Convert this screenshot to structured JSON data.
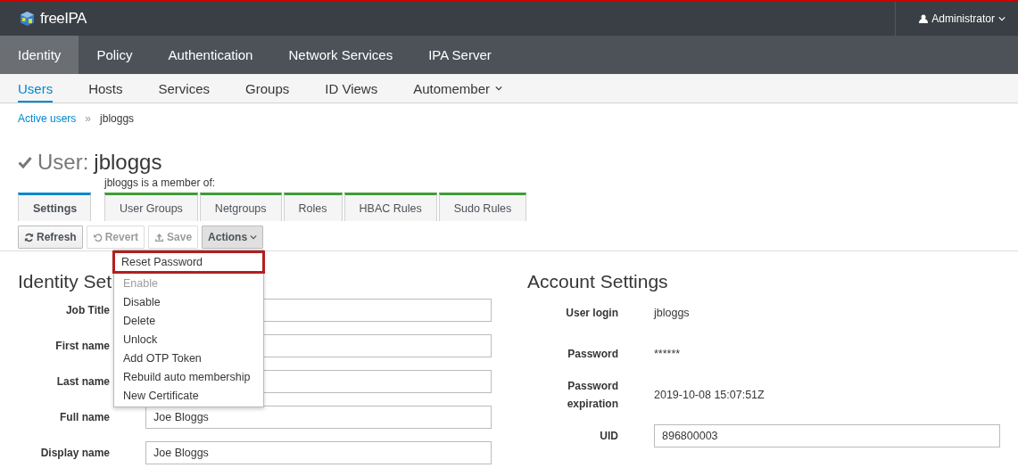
{
  "header": {
    "brand": "freeIPA",
    "user": "Administrator"
  },
  "nav": [
    {
      "label": "Identity",
      "selected": true
    },
    {
      "label": "Policy",
      "selected": false
    },
    {
      "label": "Authentication",
      "selected": false
    },
    {
      "label": "Network Services",
      "selected": false
    },
    {
      "label": "IPA Server",
      "selected": false
    }
  ],
  "subnav": [
    {
      "label": "Users",
      "selected": true,
      "dropdown": false
    },
    {
      "label": "Hosts",
      "selected": false,
      "dropdown": false
    },
    {
      "label": "Services",
      "selected": false,
      "dropdown": false
    },
    {
      "label": "Groups",
      "selected": false,
      "dropdown": false
    },
    {
      "label": "ID Views",
      "selected": false,
      "dropdown": false
    },
    {
      "label": "Automember",
      "selected": false,
      "dropdown": true
    }
  ],
  "breadcrumb": {
    "link": "Active users",
    "separator": "»",
    "current": "jbloggs"
  },
  "page_title": {
    "prefix": "User:",
    "name": "jbloggs"
  },
  "facets": {
    "member_label": "jbloggs is a member of:",
    "tabs": [
      {
        "label": "Settings",
        "selected": true
      },
      {
        "label": "User Groups",
        "selected": false
      },
      {
        "label": "Netgroups",
        "selected": false
      },
      {
        "label": "Roles",
        "selected": false
      },
      {
        "label": "HBAC Rules",
        "selected": false
      },
      {
        "label": "Sudo Rules",
        "selected": false
      }
    ]
  },
  "toolbar": {
    "buttons": [
      {
        "label": "Refresh",
        "kind": "refresh",
        "disabled": false
      },
      {
        "label": "Revert",
        "kind": "revert",
        "disabled": true
      },
      {
        "label": "Save",
        "kind": "save",
        "disabled": true
      }
    ],
    "actions": {
      "label": "Actions",
      "expanded": true,
      "menu": [
        {
          "label": "Reset Password",
          "disabled": false,
          "focused": true
        },
        {
          "label": "Enable",
          "disabled": true,
          "focused": false
        },
        {
          "label": "Disable",
          "disabled": false,
          "focused": false
        },
        {
          "label": "Delete",
          "disabled": false,
          "focused": false
        },
        {
          "label": "Unlock",
          "disabled": false,
          "focused": false
        },
        {
          "label": "Add OTP Token",
          "disabled": false,
          "focused": false
        },
        {
          "label": "Rebuild auto membership",
          "disabled": false,
          "focused": false
        },
        {
          "label": "New Certificate",
          "disabled": false,
          "focused": false
        }
      ]
    }
  },
  "identity_settings": {
    "title": "Identity Set",
    "fields": [
      {
        "label": "Job Title"
      },
      {
        "label": "First name"
      },
      {
        "label": "Last name"
      },
      {
        "label": "Full name",
        "value": "Joe Bloggs"
      },
      {
        "label": "Display name",
        "value": "Joe Bloggs"
      }
    ]
  },
  "account_settings": {
    "title": "Account Settings",
    "fields": [
      {
        "label": "User login",
        "kind": "text",
        "value": "jbloggs"
      },
      {
        "label": "Password",
        "kind": "text",
        "value": "******"
      },
      {
        "label": "Password expiration",
        "kind": "text",
        "value": "2019-10-08 15:07:51Z"
      },
      {
        "label": "UID",
        "kind": "input",
        "value": "896800003"
      }
    ]
  }
}
